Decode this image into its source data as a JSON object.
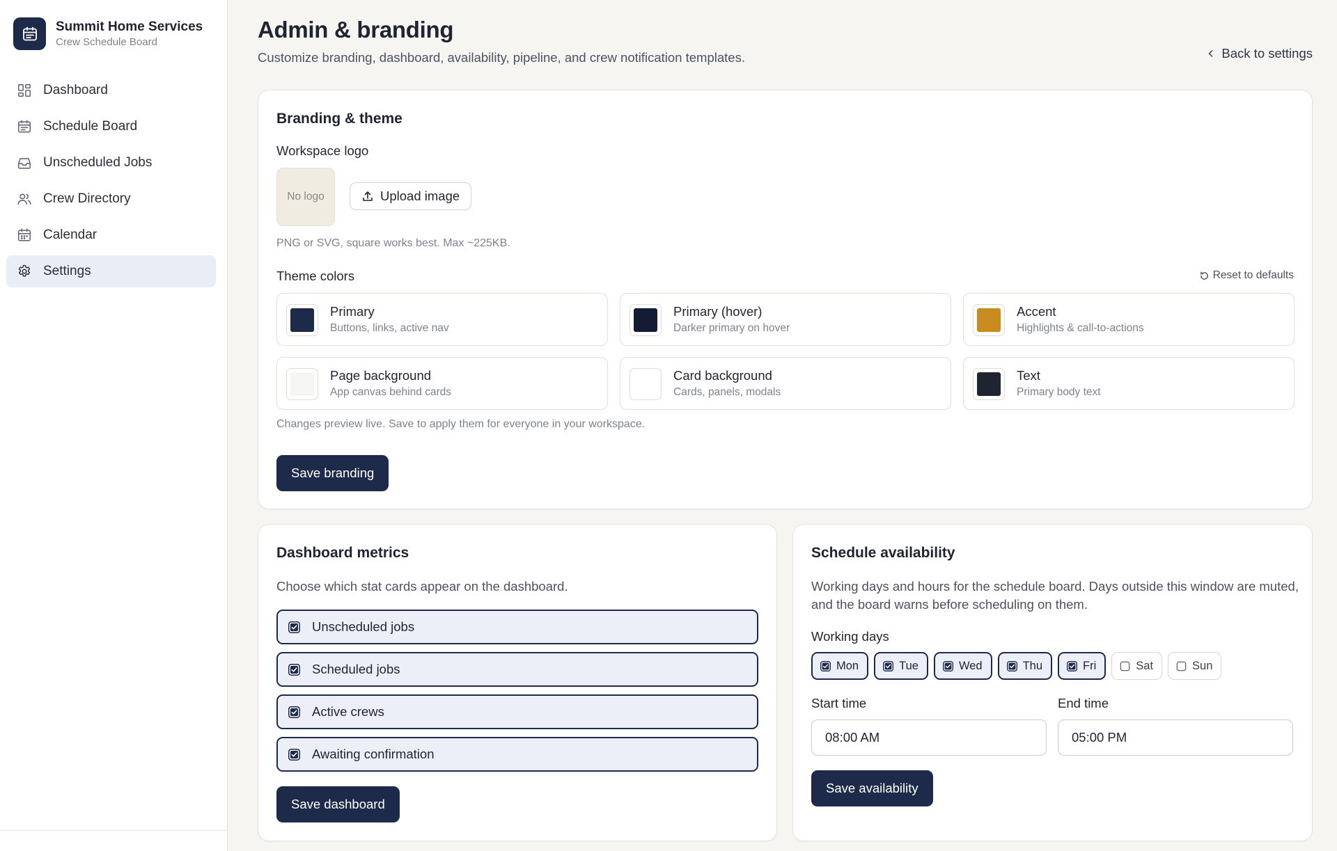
{
  "sidebar": {
    "brand_name": "Summit Home Services",
    "brand_sub": "Crew Schedule Board",
    "items": [
      {
        "label": "Dashboard",
        "icon": "dashboard-icon"
      },
      {
        "label": "Schedule Board",
        "icon": "calendar-board-icon"
      },
      {
        "label": "Unscheduled Jobs",
        "icon": "inbox-icon"
      },
      {
        "label": "Crew Directory",
        "icon": "users-icon"
      },
      {
        "label": "Calendar",
        "icon": "calendar-icon"
      },
      {
        "label": "Settings",
        "icon": "gear-icon",
        "active": true
      }
    ]
  },
  "header": {
    "title": "Admin & branding",
    "subtitle": "Customize branding, dashboard, availability, pipeline, and crew notification templates.",
    "back_label": "Back to settings"
  },
  "branding": {
    "title": "Branding & theme",
    "logo_label": "Workspace logo",
    "logo_placeholder": "No logo",
    "upload_label": "Upload image",
    "logo_hint": "PNG or SVG, square works best. Max ~225KB.",
    "theme_label": "Theme colors",
    "reset_label": "Reset to defaults",
    "colors": [
      {
        "name": "Primary",
        "desc": "Buttons, links, active nav",
        "hex": "#1e2a4a"
      },
      {
        "name": "Primary (hover)",
        "desc": "Darker primary on hover",
        "hex": "#141c33"
      },
      {
        "name": "Accent",
        "desc": "Highlights & call-to-actions",
        "hex": "#c98a1e"
      },
      {
        "name": "Page background",
        "desc": "App canvas behind cards",
        "hex": "#f6f5f2"
      },
      {
        "name": "Card background",
        "desc": "Cards, panels, modals",
        "hex": "#ffffff"
      },
      {
        "name": "Text",
        "desc": "Primary body text",
        "hex": "#1f2430"
      }
    ],
    "preview_hint": "Changes preview live. Save to apply them for everyone in your workspace.",
    "save_label": "Save branding"
  },
  "metrics": {
    "title": "Dashboard metrics",
    "desc": "Choose which stat cards appear on the dashboard.",
    "items": [
      {
        "label": "Unscheduled jobs",
        "checked": true
      },
      {
        "label": "Scheduled jobs",
        "checked": true
      },
      {
        "label": "Active crews",
        "checked": true
      },
      {
        "label": "Awaiting confirmation",
        "checked": true
      }
    ],
    "save_label": "Save dashboard"
  },
  "availability": {
    "title": "Schedule availability",
    "desc": "Working days and hours for the schedule board. Days outside this window are muted, and the board warns before scheduling on them.",
    "days_label": "Working days",
    "days": [
      {
        "label": "Mon",
        "checked": true
      },
      {
        "label": "Tue",
        "checked": true
      },
      {
        "label": "Wed",
        "checked": true
      },
      {
        "label": "Thu",
        "checked": true
      },
      {
        "label": "Fri",
        "checked": true
      },
      {
        "label": "Sat",
        "checked": false
      },
      {
        "label": "Sun",
        "checked": false
      }
    ],
    "start_label": "Start time",
    "start_value": "08:00 AM",
    "end_label": "End time",
    "end_value": "05:00 PM",
    "save_label": "Save availability"
  },
  "colors": {
    "primary": "#1e2a4a",
    "accent": "#c98a1e"
  }
}
